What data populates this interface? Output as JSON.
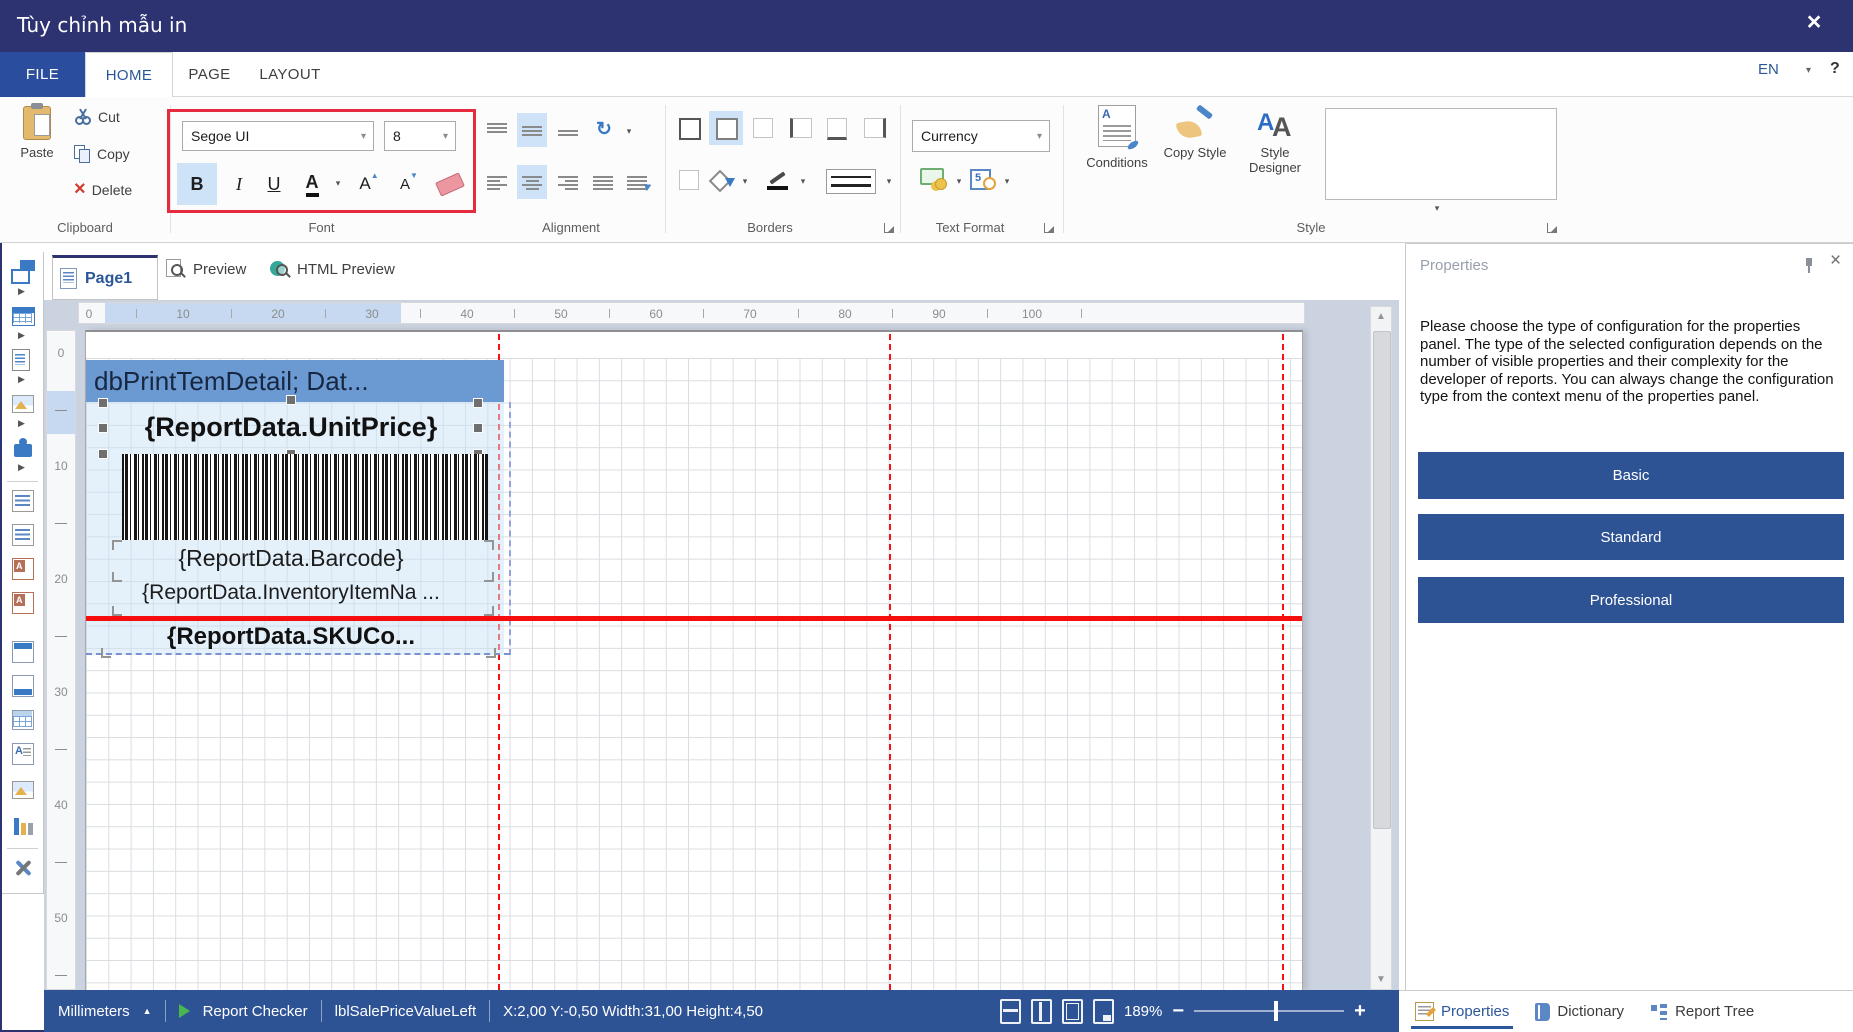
{
  "window": {
    "title": "Tùy chỉnh mẫu in",
    "close": "×"
  },
  "ribbon_tabs": {
    "file": "FILE",
    "home": "HOME",
    "page": "PAGE",
    "layout": "LAYOUT",
    "language": "EN",
    "help": "?"
  },
  "clipboard": {
    "paste": "Paste",
    "cut": "Cut",
    "copy": "Copy",
    "delete": "Delete",
    "group": "Clipboard"
  },
  "font": {
    "family": "Segoe UI",
    "size": "8",
    "bold": "B",
    "italic": "I",
    "underline": "U",
    "color": "A",
    "grow": "A",
    "shrink": "A",
    "group": "Font"
  },
  "alignment": {
    "group": "Alignment"
  },
  "borders": {
    "group": "Borders"
  },
  "text_format": {
    "selected_format": "Currency",
    "group": "Text Format"
  },
  "style": {
    "conditions": "Conditions",
    "copy_style": "Copy Style",
    "style_designer": "Style Designer",
    "group": "Style"
  },
  "doc_tabs": {
    "page": "Page1",
    "preview": "Preview",
    "html_preview": "HTML Preview"
  },
  "rulers": {
    "h": [
      "0",
      "10",
      "20",
      "30",
      "40",
      "50",
      "60",
      "70",
      "80",
      "90",
      "100"
    ],
    "v": [
      "0",
      "10",
      "20",
      "30",
      "40",
      "50"
    ]
  },
  "design": {
    "band_title": "dbPrintTemDetail; Dat...",
    "unit_price": "{ReportData.UnitPrice}",
    "barcode_label": "{ReportData.Barcode}",
    "inventory_label": "{ReportData.InventoryItemNa ...",
    "sku_label": "{ReportData.SKUCo..."
  },
  "status": {
    "units": "Millimeters",
    "report_checker": "Report Checker",
    "selected_element": "lblSalePriceValueLeft",
    "coords": "X:2,00  Y:-0,50  Width:31,00  Height:4,50",
    "zoom": "189%",
    "zoom_minus": "−",
    "zoom_plus": "+"
  },
  "panel": {
    "title": "Properties",
    "message": "Please choose the type of configuration for the properties panel. The type of the selected configuration depends on the number of visible properties and their complexity for the developer of reports. You can always change the configuration type from the context menu of the properties panel.",
    "buttons": [
      "Basic",
      "Standard",
      "Professional"
    ],
    "tabs": [
      "Properties",
      "Dictionary",
      "Report Tree"
    ]
  },
  "colors": {
    "titlebar": "#2d3271",
    "accent": "#2b579a",
    "status_blue": "#2e5395",
    "band_blue": "#6b9ad2",
    "highlight_red": "#e72b3f",
    "guide_red": "#fb1111",
    "selection_blue": "#c6d9f1"
  }
}
